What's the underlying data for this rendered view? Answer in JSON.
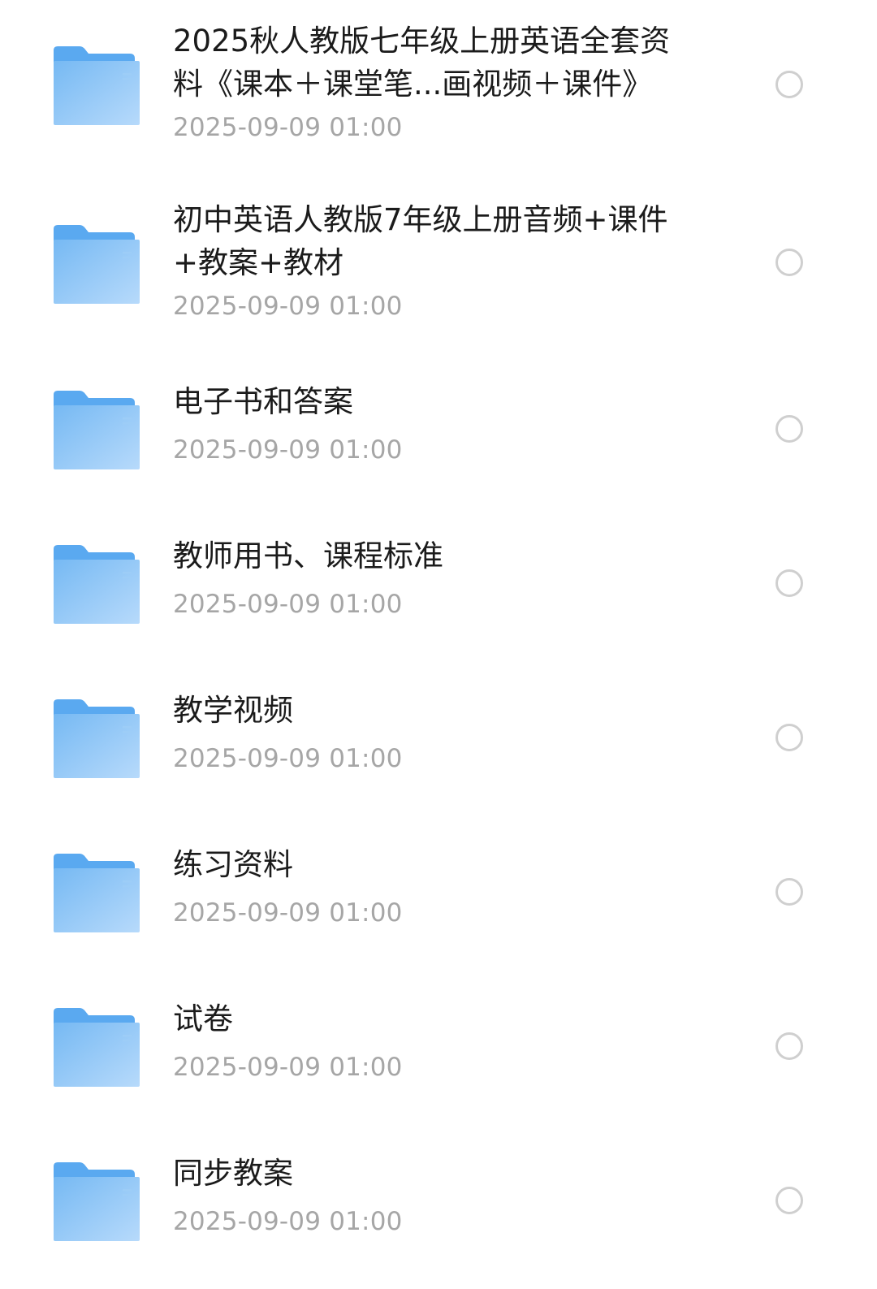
{
  "colors": {
    "folder_back": "#5aa9f0",
    "folder_front_light": "#b7dafb",
    "folder_front_dark": "#76b9f3",
    "name_text": "#1b1b1b",
    "date_text": "#a6a6a6",
    "radio_border": "#cfcfcf"
  },
  "files": [
    {
      "icon": "folder-icon",
      "name": "2025秋人教版七年级上册英语全套资料《课本＋课堂笔...画视频＋课件》",
      "date": "2025-09-09 01:00",
      "selected": false
    },
    {
      "icon": "folder-icon",
      "name": "初中英语人教版7年级上册音频+课件+教案+教材",
      "date": "2025-09-09 01:00",
      "selected": false
    },
    {
      "icon": "folder-icon",
      "name": "电子书和答案",
      "date": "2025-09-09 01:00",
      "selected": false
    },
    {
      "icon": "folder-icon",
      "name": "教师用书、课程标准",
      "date": "2025-09-09 01:00",
      "selected": false
    },
    {
      "icon": "folder-icon",
      "name": "教学视频",
      "date": "2025-09-09 01:00",
      "selected": false
    },
    {
      "icon": "folder-icon",
      "name": "练习资料",
      "date": "2025-09-09 01:00",
      "selected": false
    },
    {
      "icon": "folder-icon",
      "name": "试卷",
      "date": "2025-09-09 01:00",
      "selected": false
    },
    {
      "icon": "folder-icon",
      "name": "同步教案",
      "date": "2025-09-09 01:00",
      "selected": false
    }
  ]
}
